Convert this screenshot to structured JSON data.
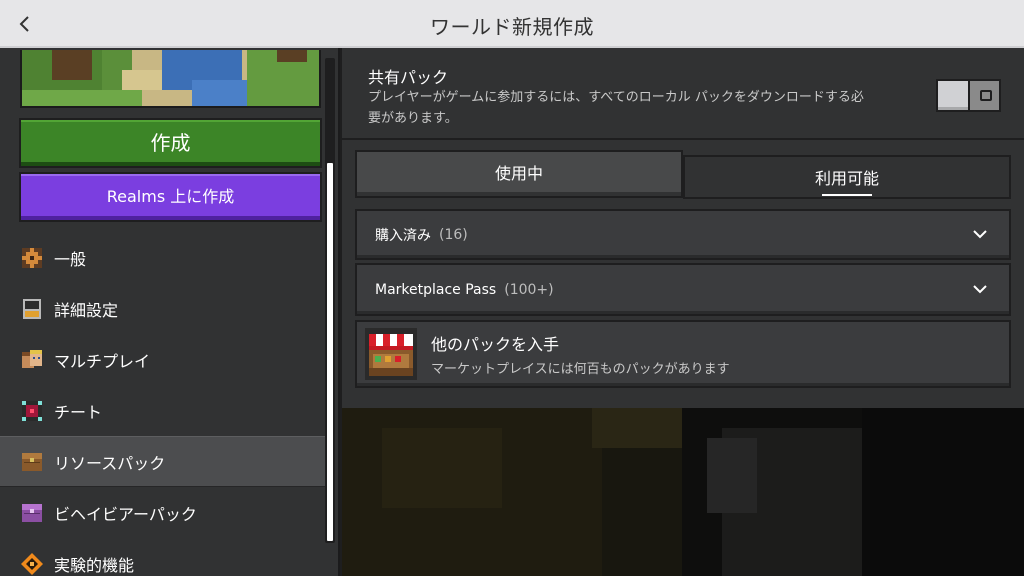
{
  "header": {
    "title": "ワールド新規作成",
    "back_icon": "chevron-left-icon"
  },
  "left": {
    "create_label": "作成",
    "realms_label": "Realms 上に作成",
    "nav": [
      {
        "label": "一般",
        "icon": "general-icon"
      },
      {
        "label": "詳細設定",
        "icon": "advanced-icon"
      },
      {
        "label": "マルチプレイ",
        "icon": "multiplayer-icon"
      },
      {
        "label": "チート",
        "icon": "cheats-icon"
      },
      {
        "label": "リソースパック",
        "icon": "resource-pack-icon",
        "active": true
      },
      {
        "label": "ビヘイビアーパック",
        "icon": "behavior-pack-icon"
      },
      {
        "label": "実験的機能",
        "icon": "experiments-icon"
      }
    ]
  },
  "shared_packs": {
    "title": "共有パック",
    "description": "プレイヤーがゲームに参加するには、すべてのローカル パックをダウンロードする必要があります。",
    "toggle_on": false
  },
  "tabs": {
    "in_use": "使用中",
    "available": "利用可能"
  },
  "purchased": {
    "label": "購入済み",
    "count": "(16)"
  },
  "marketplace_pass": {
    "label": "Marketplace Pass",
    "count": "(100+)"
  },
  "get_more": {
    "title": "他のパックを入手",
    "subtitle": "マーケットプレイスには何百ものパックがあります"
  },
  "colors": {
    "create_green": "#3c8527",
    "realms_purple": "#7b3ee0",
    "panel": "#313233"
  }
}
